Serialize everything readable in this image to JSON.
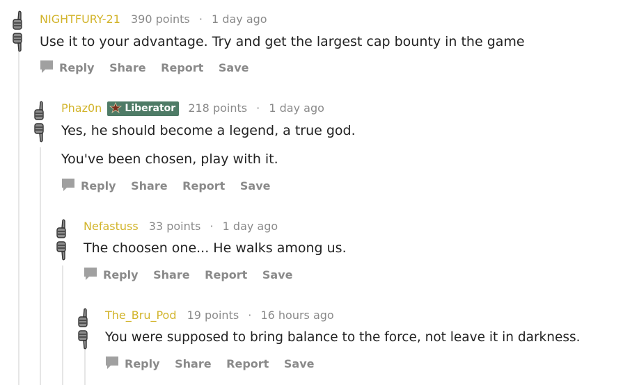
{
  "actions": {
    "reply": "Reply",
    "share": "Share",
    "report": "Report",
    "save": "Save"
  },
  "comments": [
    {
      "author": "NIGHTFURY-21",
      "points": "390 points",
      "age": "1 day ago",
      "body": [
        "Use it to your advantage. Try and get the largest cap bounty in the game"
      ]
    },
    {
      "author": "Phaz0n",
      "flair": "Liberator",
      "points": "218 points",
      "age": "1 day ago",
      "body": [
        "Yes, he should become a legend, a true god.",
        "You've been chosen, play with it."
      ]
    },
    {
      "author": "Nefastuss",
      "points": "33 points",
      "age": "1 day ago",
      "body": [
        "The choosen one... He walks among us."
      ]
    },
    {
      "author": "The_Bru_Pod",
      "points": "19 points",
      "age": "16 hours ago",
      "body": [
        "You were supposed to bring balance to the force, not leave it in darkness."
      ]
    }
  ],
  "colors": {
    "author": "#d2b42b",
    "flair_bg": "#4e7b66",
    "meta": "#8a8a8a",
    "body": "#222222",
    "thread_line": "#e6e6e6"
  }
}
